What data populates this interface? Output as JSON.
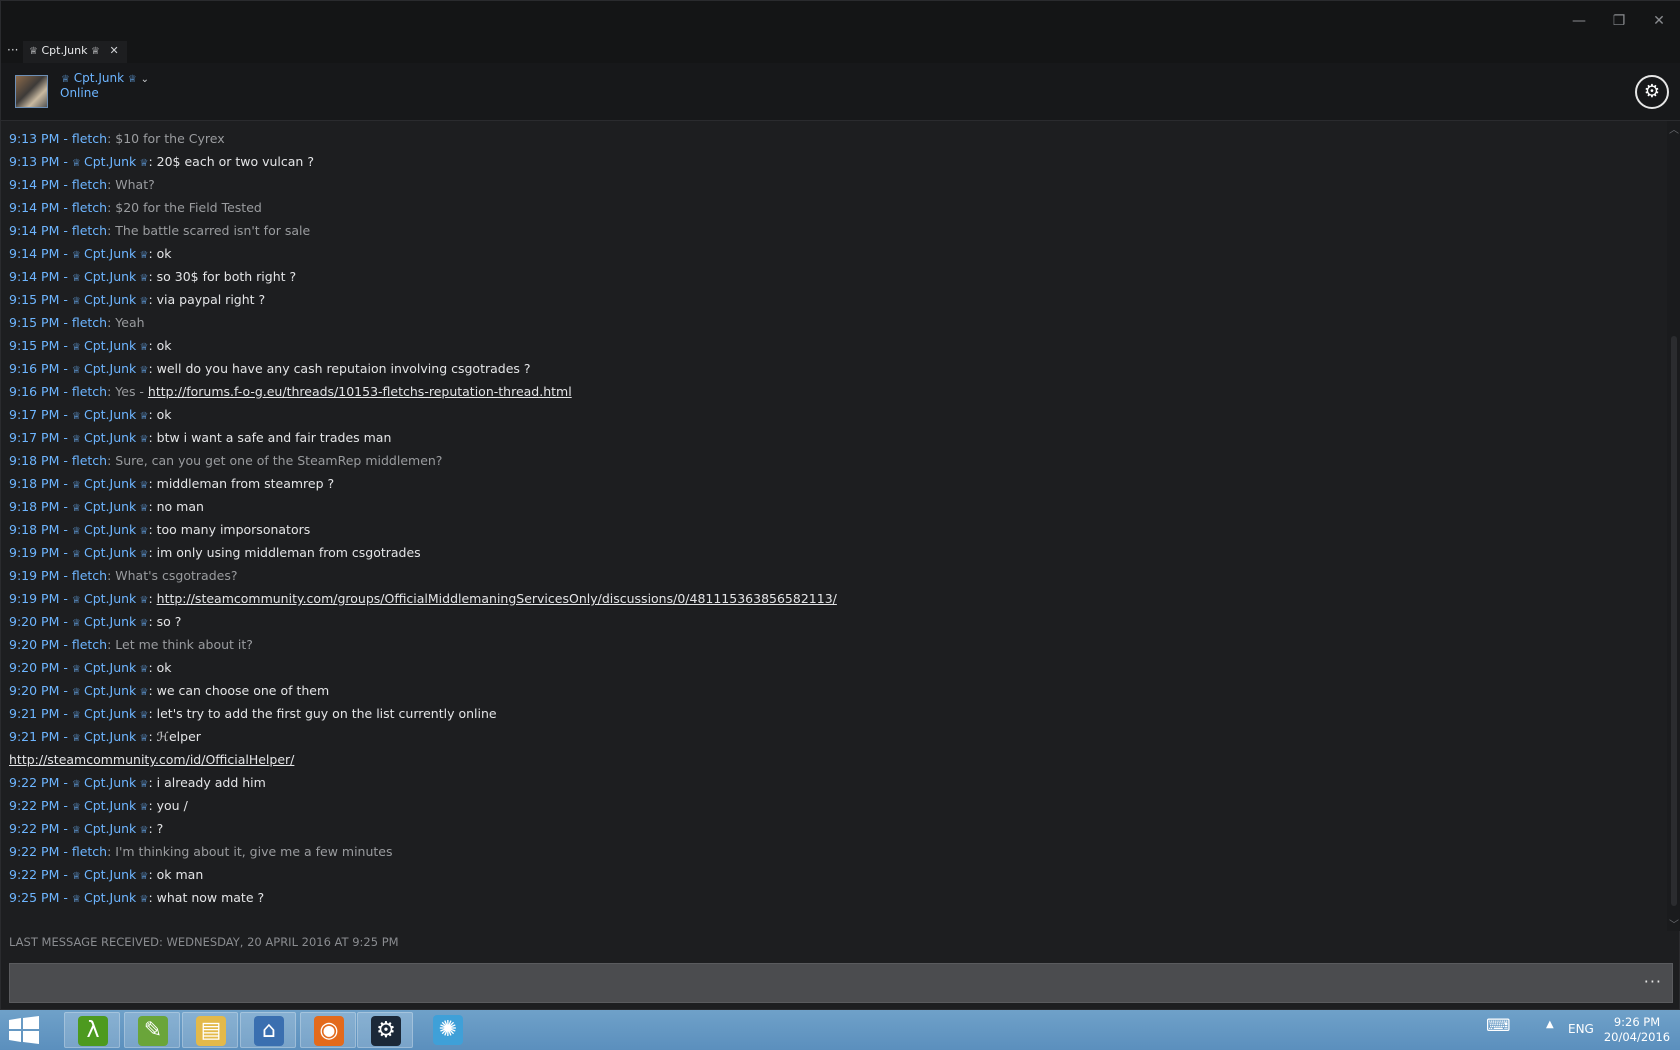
{
  "window": {
    "tab": {
      "more": "···",
      "name": "Cpt.Junk",
      "close": "✕"
    },
    "controls": {
      "minimize": "—",
      "restore": "❐",
      "close": "✕"
    }
  },
  "header": {
    "name": "Cpt.Junk",
    "status": "Online"
  },
  "messages": [
    {
      "time": "9:13 PM - ",
      "sender": "fletch",
      "role": "f",
      "text": ": $10 for the Cyrex"
    },
    {
      "time": "9:13 PM - ",
      "sender": "Cpt.Junk",
      "role": "c",
      "text": ": 20$ each or two vulcan ?"
    },
    {
      "time": "9:14 PM - ",
      "sender": "fletch",
      "role": "f",
      "text": ": What?"
    },
    {
      "time": "9:14 PM - ",
      "sender": "fletch",
      "role": "f",
      "text": ": $20 for the Field Tested"
    },
    {
      "time": "9:14 PM - ",
      "sender": "fletch",
      "role": "f",
      "text": ": The battle scarred isn't for sale"
    },
    {
      "time": "9:14 PM - ",
      "sender": "Cpt.Junk",
      "role": "c",
      "text": ": ok"
    },
    {
      "time": "9:14 PM - ",
      "sender": "Cpt.Junk",
      "role": "c",
      "text": ": so 30$ for both right ?"
    },
    {
      "time": "9:15 PM - ",
      "sender": "Cpt.Junk",
      "role": "c",
      "text": ": via paypal right ?"
    },
    {
      "time": "9:15 PM - ",
      "sender": "fletch",
      "role": "f",
      "text": ": Yeah"
    },
    {
      "time": "9:15 PM - ",
      "sender": "Cpt.Junk",
      "role": "c",
      "text": ": ok"
    },
    {
      "time": "9:16 PM - ",
      "sender": "Cpt.Junk",
      "role": "c",
      "text": ": well do you have any cash reputaion involving csgotrades ?"
    },
    {
      "time": "9:16 PM - ",
      "sender": "fletch",
      "role": "f",
      "text": ": Yes - ",
      "link": "http://forums.f-o-g.eu/threads/10153-fletchs-reputation-thread.html"
    },
    {
      "time": "9:17 PM - ",
      "sender": "Cpt.Junk",
      "role": "c",
      "text": ": ok"
    },
    {
      "time": "9:17 PM - ",
      "sender": "Cpt.Junk",
      "role": "c",
      "text": ": btw i want a safe and fair trades man"
    },
    {
      "time": "9:18 PM - ",
      "sender": "fletch",
      "role": "f",
      "text": ": Sure, can you get one of the SteamRep middlemen?"
    },
    {
      "time": "9:18 PM - ",
      "sender": "Cpt.Junk",
      "role": "c",
      "text": ": middleman from steamrep ?"
    },
    {
      "time": "9:18 PM - ",
      "sender": "Cpt.Junk",
      "role": "c",
      "text": ": no man"
    },
    {
      "time": "9:18 PM - ",
      "sender": "Cpt.Junk",
      "role": "c",
      "text": ": too many imporsonators"
    },
    {
      "time": "9:19 PM - ",
      "sender": "Cpt.Junk",
      "role": "c",
      "text": ": im only using middleman from csgotrades"
    },
    {
      "time": "9:19 PM - ",
      "sender": "fletch",
      "role": "f",
      "text": ": What's csgotrades?"
    },
    {
      "time": "9:19 PM - ",
      "sender": "Cpt.Junk",
      "role": "c",
      "text": ": ",
      "link": "http://steamcommunity.com/groups/OfficialMiddlemaningServicesOnly/discussions/0/481115363856582113/"
    },
    {
      "time": "9:20 PM - ",
      "sender": "Cpt.Junk",
      "role": "c",
      "text": ": so ?"
    },
    {
      "time": "9:20 PM - ",
      "sender": "fletch",
      "role": "f",
      "text": ": Let me think about it?"
    },
    {
      "time": "9:20 PM - ",
      "sender": "Cpt.Junk",
      "role": "c",
      "text": ": ok"
    },
    {
      "time": "9:20 PM - ",
      "sender": "Cpt.Junk",
      "role": "c",
      "text": ": we can choose one of them"
    },
    {
      "time": "9:21 PM - ",
      "sender": "Cpt.Junk",
      "role": "c",
      "text": ": let's try to add the first guy on the list currently online"
    },
    {
      "time": "9:21 PM - ",
      "sender": "Cpt.Junk",
      "role": "c",
      "text": ": ℋelper"
    },
    {
      "time": "",
      "sender": "",
      "role": "n",
      "text": "",
      "link": "http://steamcommunity.com/id/OfficialHelper/"
    },
    {
      "time": "9:22 PM - ",
      "sender": "Cpt.Junk",
      "role": "c",
      "text": ": i already add him"
    },
    {
      "time": "9:22 PM - ",
      "sender": "Cpt.Junk",
      "role": "c",
      "text": ": you /"
    },
    {
      "time": "9:22 PM - ",
      "sender": "Cpt.Junk",
      "role": "c",
      "text": ": ?"
    },
    {
      "time": "9:22 PM - ",
      "sender": "fletch",
      "role": "f",
      "text": ": I'm thinking about it, give me a few minutes"
    },
    {
      "time": "9:22 PM - ",
      "sender": "Cpt.Junk",
      "role": "c",
      "text": ": ok man"
    },
    {
      "time": "9:25 PM - ",
      "sender": "Cpt.Junk",
      "role": "c",
      "text": ": what now mate ?"
    }
  ],
  "last_message": "LAST MESSAGE RECEIVED: WEDNESDAY, 20 APRIL 2016 AT 9:25 PM",
  "input": {
    "value": "",
    "more": "···"
  },
  "taskbar": {
    "apps": [
      {
        "name": "lambda-app",
        "glyph": "λ",
        "color": "#4d9a1f"
      },
      {
        "name": "notepad-app",
        "glyph": "✎",
        "color": "#6aa53a"
      },
      {
        "name": "file-explorer-app",
        "glyph": "▤",
        "color": "#e3b94a"
      },
      {
        "name": "network-app",
        "glyph": "⌂",
        "color": "#3a6fb0"
      },
      {
        "name": "firefox-app",
        "glyph": "◉",
        "color": "#e36a1c"
      },
      {
        "name": "steam-app",
        "glyph": "⚙",
        "color": "#1b2838"
      },
      {
        "name": "swirl-app",
        "glyph": "✺",
        "color": "#3fa0d8"
      }
    ],
    "lang": "ENG",
    "time": "9:26 PM",
    "date": "20/04/2016"
  }
}
